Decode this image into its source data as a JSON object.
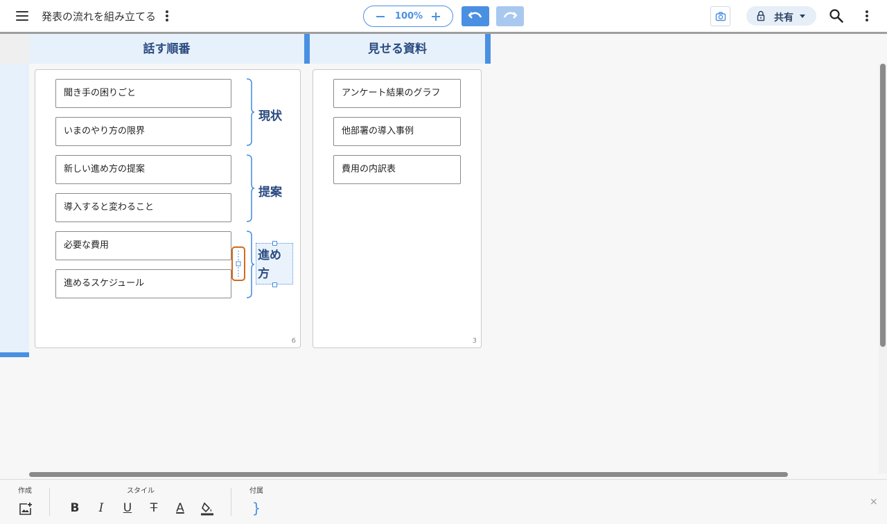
{
  "header": {
    "title": "発表の流れを組み立てる",
    "zoom": "100%",
    "share_label": "共有"
  },
  "columns": [
    {
      "title": "話す順番",
      "count": "6"
    },
    {
      "title": "見せる資料",
      "count": "3"
    }
  ],
  "order_cards": [
    "聞き手の困りごと",
    "いまのやり方の限界",
    "新しい進め方の提案",
    "導入すると変わること",
    "必要な費用",
    "進めるスケジュール"
  ],
  "groups": [
    {
      "label": "現状"
    },
    {
      "label": "提案"
    },
    {
      "label": "進め方"
    }
  ],
  "material_cards": [
    "アンケート結果のグラフ",
    "他部署の導入事例",
    "費用の内訳表"
  ],
  "toolbar": {
    "create_label": "作成",
    "style_label": "スタイル",
    "attach_label": "付属",
    "bold": "B",
    "italic": "I",
    "underline": "U",
    "strike": "T",
    "text_color": "A",
    "brace": "}",
    "close": "×"
  },
  "colors": {
    "accent": "#4a90e2",
    "header_bg": "#e6f1fb",
    "selection": "#d2691e",
    "label_text": "#2a4a7f"
  },
  "icons": [
    "menu-icon",
    "kebab-icon",
    "minus-icon",
    "plus-icon",
    "undo-icon",
    "redo-icon",
    "camera-icon",
    "lock-icon",
    "caret-down-icon",
    "search-icon",
    "add-image-icon",
    "fill-color-icon",
    "brace-icon",
    "close-icon"
  ]
}
